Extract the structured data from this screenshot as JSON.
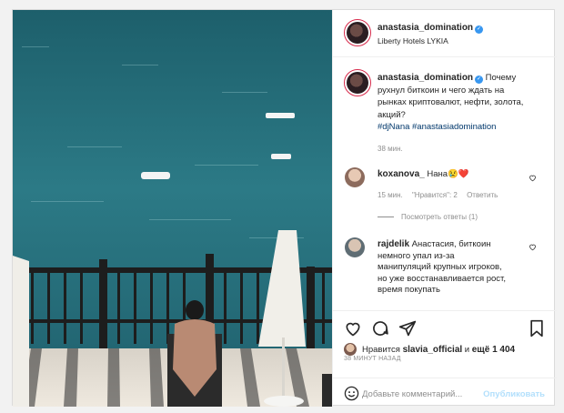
{
  "header": {
    "username": "anastasia_domination",
    "location": "Liberty Hotels LYKIA"
  },
  "caption": {
    "username": "anastasia_domination",
    "text_line1": "Почему",
    "text_line2": "рухнул биткоин и чего ждать на",
    "text_line3": "рынках криптовалют, нефти, золота,",
    "text_line4": "акций?",
    "hashtags": "#djNana #anastasiadomination",
    "time": "38 мин."
  },
  "comments": [
    {
      "username": "koxanova_",
      "text": "Нана😢❤️",
      "time": "15 мин.",
      "likes": "\"Нравится\": 2",
      "reply_label": "Ответить",
      "view_replies": "Посмотреть ответы (1)"
    },
    {
      "username": "rajdelik",
      "text_line1": "Анастасия, биткоин",
      "text_line2": "немного упал из-за",
      "text_line3": "манипуляций крупных игроков,",
      "text_line4": "но уже восстанавливается рост,",
      "text_line5": "время покупать"
    }
  ],
  "likes": {
    "prefix": "Нравится",
    "liker": "slavia_official",
    "joiner": "и",
    "others": "ещё 1 404"
  },
  "post_time": "38 МИНУТ НАЗАД",
  "comment_input": {
    "placeholder": "Добавьте комментарий...",
    "post_label": "Опубликовать"
  },
  "icons": {
    "verified": "verified-badge-icon",
    "like": "heart-icon",
    "comment": "comment-icon",
    "share": "share-icon",
    "save": "bookmark-icon",
    "emoji": "emoji-icon"
  },
  "colors": {
    "link": "#00376b",
    "verified": "#3897f0",
    "post_disabled": "#b2dffc"
  }
}
